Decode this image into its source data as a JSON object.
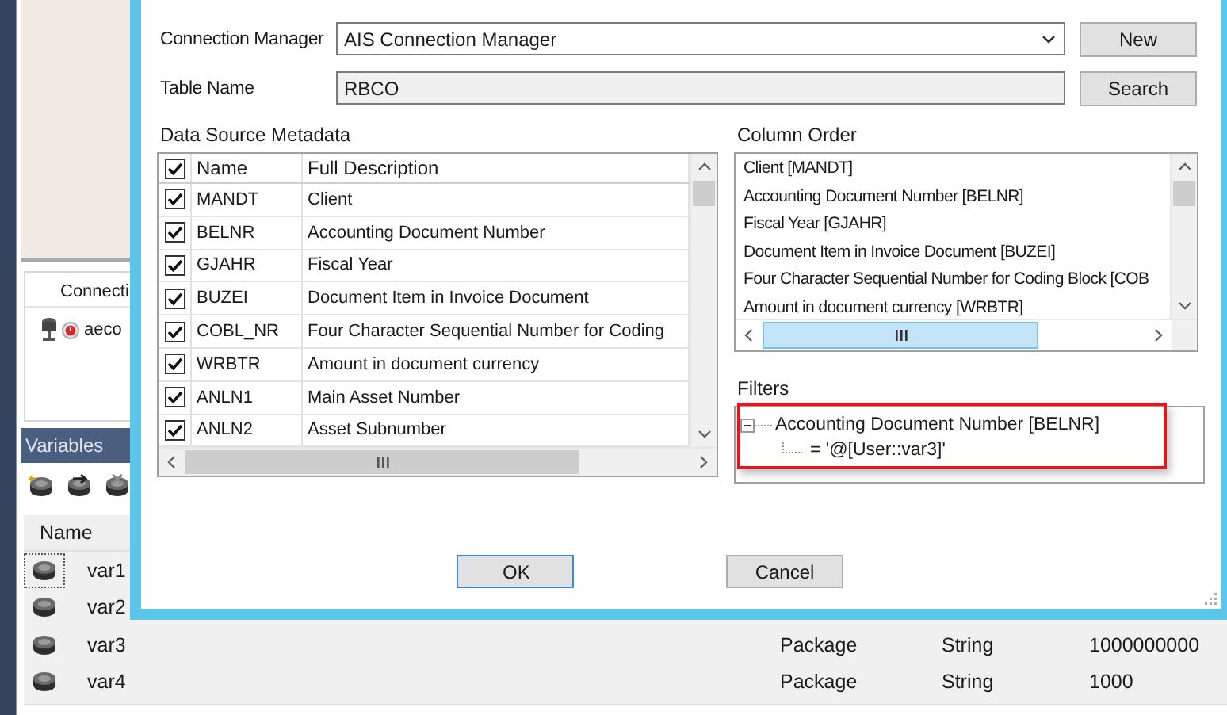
{
  "connections_panel": {
    "header": "Connecti",
    "items": [
      {
        "label": "aeco"
      }
    ]
  },
  "variables_panel": {
    "title": "Variables",
    "columns": [
      "Name"
    ],
    "rows": [
      {
        "name": "var1",
        "focused": true
      },
      {
        "name": "var2",
        "focused": false
      },
      {
        "name": "var3",
        "focused": false,
        "column_2": "Package",
        "column_3": "String",
        "column_4": "1000000000"
      },
      {
        "name": "var4",
        "focused": false,
        "column_2": "Package",
        "column_3": "String",
        "column_4": "1000"
      }
    ]
  },
  "dialog": {
    "connection_manager": {
      "label": "Connection Manager",
      "value": "AIS Connection Manager"
    },
    "new_button": "New",
    "table_name": {
      "label": "Table Name",
      "value": "RBCO"
    },
    "search_button": "Search",
    "metadata": {
      "title": "Data Source Metadata",
      "all_checked": true,
      "columns": [
        "Name",
        "Full Description"
      ],
      "rows": [
        {
          "name": "MANDT",
          "description": "Client",
          "checked": true
        },
        {
          "name": "BELNR",
          "description": "Accounting Document Number",
          "checked": true
        },
        {
          "name": "GJAHR",
          "description": "Fiscal Year",
          "checked": true
        },
        {
          "name": "BUZEI",
          "description": "Document Item in Invoice Document",
          "checked": true
        },
        {
          "name": "COBL_NR",
          "description": "Four Character Sequential Number for Coding",
          "checked": true
        },
        {
          "name": "WRBTR",
          "description": "Amount in document currency",
          "checked": true
        },
        {
          "name": "ANLN1",
          "description": "Main Asset Number",
          "checked": true
        },
        {
          "name": "ANLN2",
          "description": "Asset Subnumber",
          "checked": true
        }
      ]
    },
    "column_order": {
      "title": "Column Order",
      "items": [
        "Client [MANDT]",
        "Accounting Document Number [BELNR]",
        "Fiscal Year [GJAHR]",
        "Document Item in Invoice Document [BUZEI]",
        "Four Character Sequential Number for Coding Block [COB",
        "Amount in document currency [WRBTR]"
      ]
    },
    "filters": {
      "title": "Filters",
      "highlighted": true,
      "items": [
        {
          "label": "Accounting Document Number [BELNR]",
          "expanded": true,
          "children": [
            {
              "label": "= '@[User::var3]'"
            }
          ]
        }
      ]
    },
    "buttons": [
      {
        "label": "OK",
        "focused": true
      },
      {
        "label": "Cancel",
        "focused": false
      }
    ]
  }
}
